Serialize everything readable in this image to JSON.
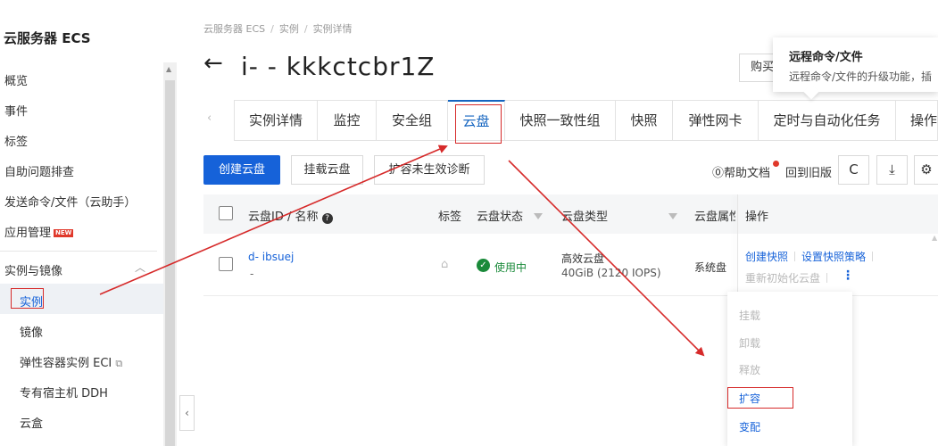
{
  "sidebar": {
    "title": "云服务器 ECS",
    "items": [
      {
        "label": "概览"
      },
      {
        "label": "事件"
      },
      {
        "label": "标签"
      },
      {
        "label": "自助问题排查"
      },
      {
        "label": "发送命令/文件（云助手）"
      },
      {
        "label": "应用管理",
        "badge": "NEW"
      }
    ],
    "group": {
      "label": "实例与镜像",
      "expanded": true
    },
    "sub_items": [
      {
        "label": "实例",
        "selected": true
      },
      {
        "label": "镜像"
      },
      {
        "label": "弹性容器实例 ECI",
        "external": true
      },
      {
        "label": "专有宿主机 DDH"
      },
      {
        "label": "云盒"
      }
    ],
    "collapse_icon": "chevron-left-icon"
  },
  "breadcrumb": [
    "云服务器 ECS",
    "实例",
    "实例详情"
  ],
  "header": {
    "title": "i-          -       kkkctcbr1Z",
    "buy_label": "购买"
  },
  "tooltip": {
    "title": "远程命令/文件",
    "description": "远程命令/文件的升级功能，插"
  },
  "tabs": [
    {
      "label": "实例详情"
    },
    {
      "label": "监控"
    },
    {
      "label": "安全组"
    },
    {
      "label": "云盘",
      "active": true
    },
    {
      "label": "快照一致性组"
    },
    {
      "label": "快照"
    },
    {
      "label": "弹性网卡"
    },
    {
      "label": "定时与自动化任务"
    },
    {
      "label": "操作"
    }
  ],
  "toolbar": {
    "create_label": "创建云盘",
    "mount_label": "挂载云盘",
    "diag_label": "扩容未生效诊断",
    "help_label": "帮助文档",
    "old_label": "回到旧版"
  },
  "table": {
    "columns": [
      "云盘ID / 名称",
      "标签",
      "云盘状态",
      "云盘类型",
      "云盘属性",
      "操作"
    ],
    "rows": [
      {
        "id": "d-             ibsuej",
        "name": "-",
        "status": "使用中",
        "type": "高效云盘",
        "size": "40GiB (2120 IOPS)",
        "attribute": "系统盘",
        "actions": [
          "创建快照",
          "设置快照策略",
          "重新初始化云盘"
        ]
      }
    ]
  },
  "dropdown": {
    "items": [
      {
        "label": "挂载",
        "enabled": false
      },
      {
        "label": "卸载",
        "enabled": false
      },
      {
        "label": "释放",
        "enabled": false
      },
      {
        "label": "扩容",
        "enabled": true,
        "highlighted": true
      },
      {
        "label": "变配",
        "enabled": true
      }
    ]
  },
  "colors": {
    "primary": "#1662d9",
    "annotation": "#d62a2a",
    "status_ok": "#1a8a3a"
  }
}
